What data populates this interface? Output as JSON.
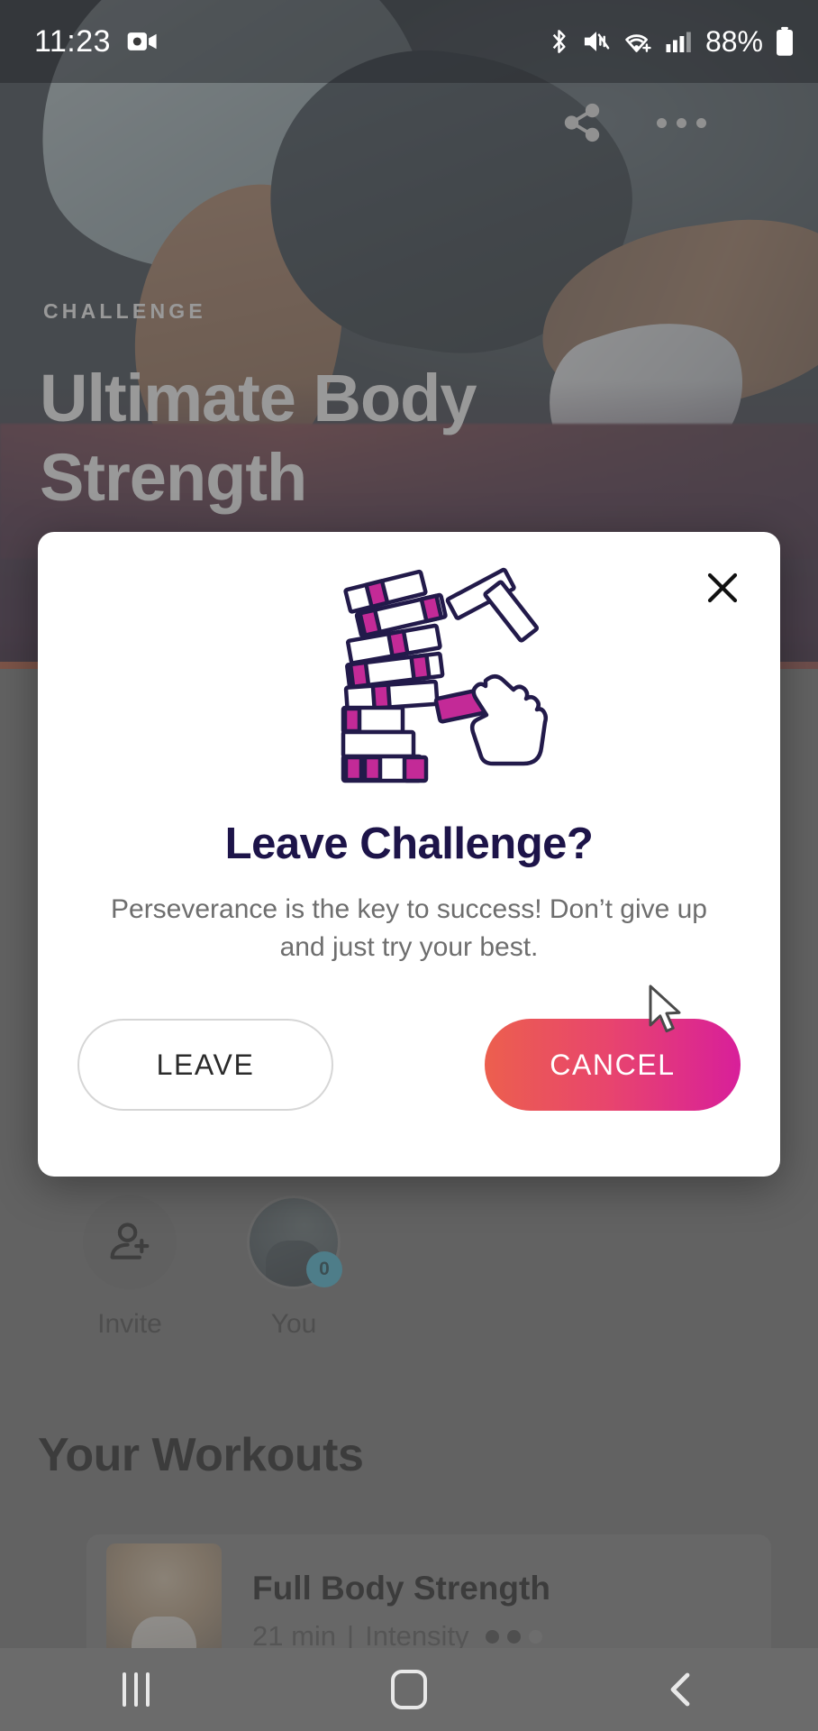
{
  "status_bar": {
    "time": "11:23",
    "battery_text": "88%",
    "left_icons": [
      "screen-record-icon"
    ],
    "right_icons": [
      "bluetooth-icon",
      "mute-icon",
      "wifi-calling-icon",
      "cellular-signal-icon",
      "battery-icon"
    ]
  },
  "hero": {
    "eyebrow": "CHALLENGE",
    "title": "Ultimate Body Strength",
    "share_icon": "share-icon",
    "more_icon": "more-options-icon"
  },
  "members": {
    "invite_label": "Invite",
    "invite_icon": "add-person-icon",
    "you_label": "You",
    "you_badge": "0"
  },
  "workouts": {
    "section_title": "Your Workouts",
    "items": [
      {
        "name": "Full Body Strength",
        "duration": "21 min",
        "separator": "|",
        "intensity_label": "Intensity",
        "intensity_filled": 2,
        "intensity_total": 3
      }
    ]
  },
  "dialog": {
    "close_icon": "close-icon",
    "illustration": "jenga-tower-hand-icon",
    "title": "Leave Challenge?",
    "body": "Perseverance is the key to success! Don’t give up and just try your best.",
    "leave_label": "LEAVE",
    "cancel_label": "CANCEL",
    "accent_start": "#ec5f4e",
    "accent_end": "#d81f9a",
    "title_color": "#1d1449"
  },
  "nav_bar": {
    "recents_icon": "recents-icon",
    "home_icon": "home-icon",
    "back_icon": "back-icon"
  },
  "cursor": {
    "icon": "mouse-pointer-icon"
  }
}
